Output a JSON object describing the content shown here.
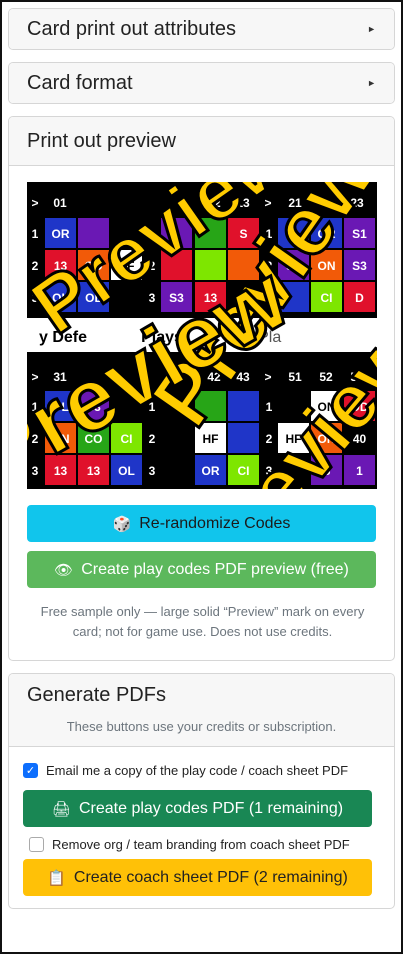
{
  "panels": {
    "attributes": {
      "title": "Card print out attributes"
    },
    "format": {
      "title": "Card format"
    },
    "preview": {
      "title": "Print out preview"
    }
  },
  "preview_card": {
    "top_row_labels": [
      ">",
      "01",
      "",
      "",
      "12",
      "13",
      ">",
      "21",
      "22",
      "23"
    ],
    "mid_row_labels": [
      ">",
      "31",
      "",
      "",
      "42",
      "43",
      ">",
      "51",
      "52",
      "53"
    ],
    "banner_left": "y Defe",
    "banner_mid": "Plays",
    "banner_right": "MyPla",
    "watermark": "Preview",
    "row_numbers": [
      "1",
      "2",
      "3"
    ],
    "cells_top": [
      [
        "OR",
        "",
        "",
        "",
        "",
        "S",
        "R",
        "OR",
        "S1"
      ],
      [
        "13",
        "OD",
        "HF",
        "",
        "",
        "",
        "S1",
        "ON",
        "S3"
      ],
      [
        "OL",
        "OL",
        "",
        "S3",
        "13",
        "",
        "",
        "CI",
        "D"
      ]
    ],
    "cells_bottom": [
      [
        "OL",
        "S3",
        "",
        "",
        "",
        "",
        "",
        "ON",
        "OD"
      ],
      [
        "ON",
        "CO",
        "CI",
        "",
        "HF",
        "",
        "HF",
        "ON",
        "40"
      ],
      [
        "13",
        "13",
        "OL",
        "",
        "OR",
        "CI",
        "",
        "S",
        "1"
      ]
    ],
    "colors": {
      "purple": "#6a18b4",
      "blue": "#1f35c8",
      "red": "#e0112b",
      "orange": "#f25a08",
      "green": "#27a517",
      "lime": "#7ee600",
      "white": "#ffffff",
      "black": "#000000",
      "yellow": "#ffcc00"
    }
  },
  "buttons": {
    "rerandomize": {
      "icon": "dice-icon",
      "glyph": "🎲",
      "label": "Re-randomize Codes"
    },
    "pdf_preview": {
      "icon": "eye-icon",
      "glyph": "👁",
      "label": "Create play codes PDF preview (free)"
    },
    "create_codes": {
      "icon": "printer-icon",
      "glyph": "🖨",
      "label": "Create play codes PDF (1 remaining)"
    },
    "create_coach": {
      "icon": "clipboard-icon",
      "glyph": "📋",
      "label": "Create coach sheet PDF (2 remaining)"
    }
  },
  "preview_note": "Free sample only — large solid “Preview” mark on every card; not for game use. Does not use credits.",
  "generate": {
    "title": "Generate PDFs",
    "subtitle": "These buttons use your credits or subscription.",
    "email_label": "Email me a copy of the play code / coach sheet PDF",
    "email_checked": true,
    "branding_label": "Remove org / team branding from coach sheet PDF",
    "branding_checked": false
  }
}
